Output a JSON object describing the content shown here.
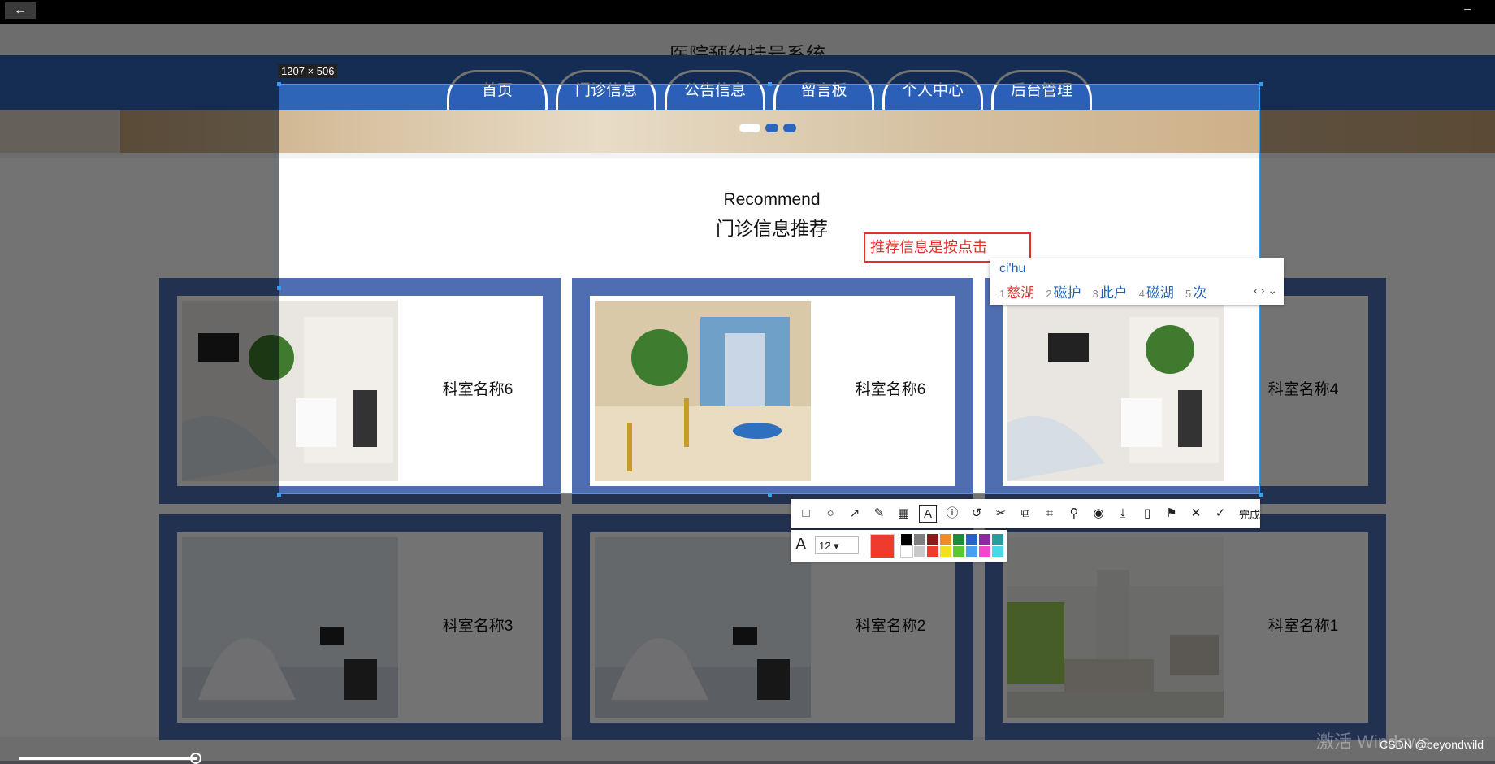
{
  "window": {
    "back_label": "←",
    "minimize_label": "–"
  },
  "site": {
    "title": "医院预约挂号系统"
  },
  "nav": [
    {
      "label": "首页"
    },
    {
      "label": "门诊信息"
    },
    {
      "label": "公告信息"
    },
    {
      "label": "留言板"
    },
    {
      "label": "个人中心"
    },
    {
      "label": "后台管理"
    }
  ],
  "section": {
    "title_en": "Recommend",
    "title_cn": "门诊信息推荐"
  },
  "annotation_text": {
    "value": "推荐信息是按点击"
  },
  "ime": {
    "pinyin": "ci'hu",
    "candidates": [
      {
        "n": "1",
        "text": "慈湖"
      },
      {
        "n": "2",
        "text": "磁护"
      },
      {
        "n": "3",
        "text": "此户"
      },
      {
        "n": "4",
        "text": "磁湖"
      },
      {
        "n": "5",
        "text": "次"
      }
    ],
    "arrows": "‹ › ⌄"
  },
  "cards": [
    {
      "label": "科室名称6",
      "photo": "dental-room"
    },
    {
      "label": "科室名称6",
      "photo": "hospital-corridor"
    },
    {
      "label": "科室名称4",
      "photo": "dental-room"
    },
    {
      "label": "科室名称3",
      "photo": "dental-clinic"
    },
    {
      "label": "科室名称2",
      "photo": "dental-clinic"
    },
    {
      "label": "科室名称1",
      "photo": "lobby"
    }
  ],
  "screenshot_tool": {
    "size_label": "1207 × 506",
    "done_label": "完成",
    "font_size": "12",
    "tools": [
      "rectangle-icon",
      "circle-icon",
      "arrow-icon",
      "pen-icon",
      "mosaic-icon",
      "text-icon",
      "number-icon",
      "undo-icon",
      "cut-icon",
      "translate-icon",
      "scan-icon",
      "pin-icon",
      "record-icon",
      "download-icon",
      "save-icon",
      "bookmark-icon",
      "close-icon",
      "check-icon"
    ],
    "current_color": "#f03a2e",
    "palette": [
      "#000000",
      "#7f7f7f",
      "#8b1a1a",
      "#f08c28",
      "#1e8c3c",
      "#2a60c8",
      "#8c2aa0",
      "#2a9ca0",
      "#ffffff",
      "#c8c8c8",
      "#f03a2e",
      "#f0e020",
      "#5ac832",
      "#48a0f0",
      "#f048c8",
      "#48d8e8"
    ]
  },
  "overlay": {
    "watermark": "激活 Windows",
    "credit": "CSDN @beyondwild"
  }
}
